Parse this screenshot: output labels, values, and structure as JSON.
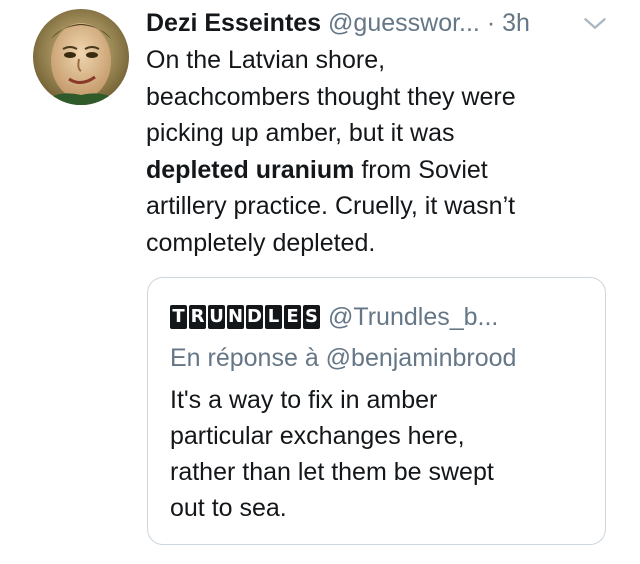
{
  "tweet": {
    "display_name": "Dezi Esseintes",
    "handle": "@guesswor...",
    "separator": "·",
    "time": "3h",
    "body_lines": [
      "On the Latvian shore,",
      "beachcombers thought they were",
      "picking up amber, but it was"
    ],
    "body_bold": "depleted uranium",
    "body_after_bold": " from Soviet",
    "body_lines_end": [
      "artillery practice. Cruelly, it wasn’t",
      "completely depleted."
    ],
    "avatar_icon": "avatar-portrait",
    "caret_icon": "chevron-down-icon"
  },
  "quote": {
    "logo_letters": [
      "T",
      "R",
      "U",
      "N",
      "D",
      "L",
      "E",
      "S"
    ],
    "logo_text": "TRUNDLES",
    "handle": "@Trundles_b...",
    "reply_to": "En réponse à @benjaminbrood",
    "body_lines": [
      "It's a way to fix in amber",
      "particular exchanges here,",
      "rather than let them be swept",
      "out to sea."
    ]
  },
  "colors": {
    "text": "#14171a",
    "muted": "#657786",
    "border": "#ccd6dd"
  }
}
